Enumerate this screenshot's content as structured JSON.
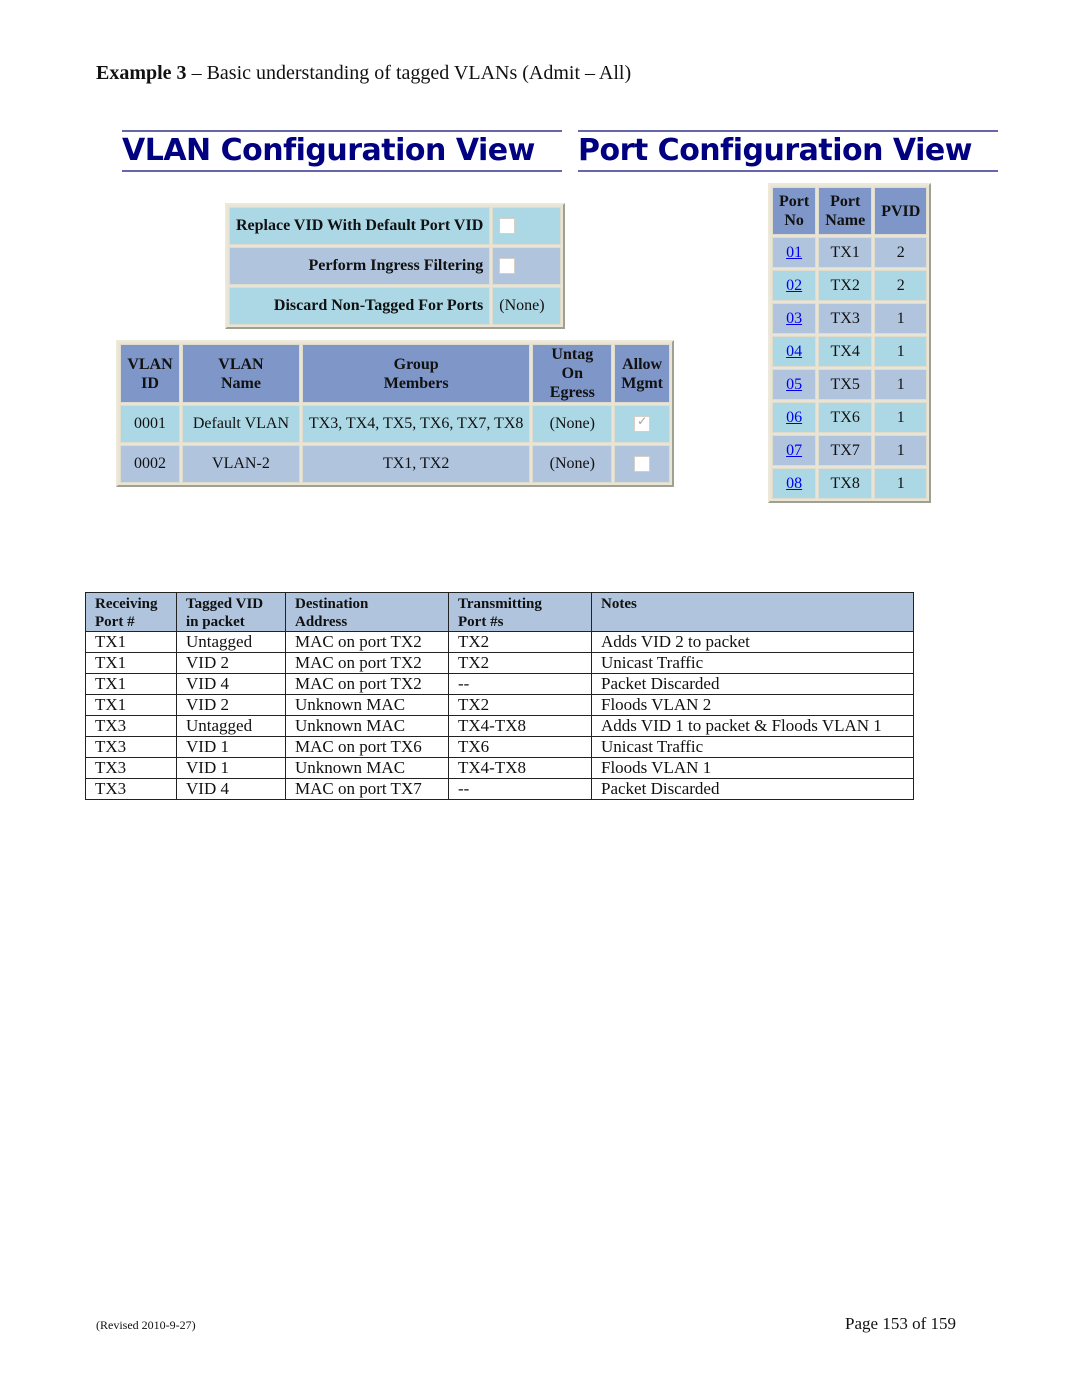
{
  "heading": {
    "bold": "Example 3",
    "rest": " – Basic understanding of tagged VLANs (Admit – All)"
  },
  "views": {
    "vlan_title": "VLAN Configuration View",
    "port_title": "Port Configuration View"
  },
  "options": [
    {
      "label": "Replace VID With Default Port VID",
      "type": "checkbox",
      "checked": false
    },
    {
      "label": "Perform Ingress Filtering",
      "type": "checkbox",
      "checked": false
    },
    {
      "label": "Discard Non-Tagged For Ports",
      "type": "text",
      "value": "(None)"
    }
  ],
  "vlan_table": {
    "headers": [
      [
        "VLAN",
        "ID"
      ],
      [
        "VLAN",
        "Name"
      ],
      [
        "Group",
        "Members"
      ],
      [
        "Untag On",
        "Egress"
      ],
      [
        "Allow",
        "Mgmt"
      ]
    ],
    "rows": [
      {
        "id": "0001",
        "name": "Default VLAN",
        "members": "TX3, TX4, TX5, TX6, TX7, TX8",
        "untag": "(None)",
        "allow_mgmt": true
      },
      {
        "id": "0002",
        "name": "VLAN-2",
        "members": "TX1, TX2",
        "untag": "(None)",
        "allow_mgmt": false
      }
    ]
  },
  "port_table": {
    "headers": [
      [
        "Port",
        "No"
      ],
      [
        "Port",
        "Name"
      ],
      [
        "PVID"
      ]
    ],
    "rows": [
      {
        "no": "01",
        "name": "TX1",
        "pvid": "2"
      },
      {
        "no": "02",
        "name": "TX2",
        "pvid": "2"
      },
      {
        "no": "03",
        "name": "TX3",
        "pvid": "1"
      },
      {
        "no": "04",
        "name": "TX4",
        "pvid": "1"
      },
      {
        "no": "05",
        "name": "TX5",
        "pvid": "1"
      },
      {
        "no": "06",
        "name": "TX6",
        "pvid": "1"
      },
      {
        "no": "07",
        "name": "TX7",
        "pvid": "1"
      },
      {
        "no": "08",
        "name": "TX8",
        "pvid": "1"
      }
    ]
  },
  "traffic_table": {
    "headers": [
      [
        "Receiving",
        "Port #"
      ],
      [
        "Tagged VID",
        "in packet"
      ],
      [
        "Destination",
        "Address"
      ],
      [
        "Transmitting",
        "Port #s"
      ],
      [
        "Notes",
        ""
      ]
    ],
    "rows": [
      [
        "TX1",
        "Untagged",
        "MAC on port TX2",
        "TX2",
        "Adds VID 2 to packet"
      ],
      [
        "TX1",
        "VID 2",
        "MAC on port TX2",
        "TX2",
        "Unicast Traffic"
      ],
      [
        "TX1",
        "VID 4",
        "MAC on port TX2",
        "--",
        "Packet Discarded"
      ],
      [
        "TX1",
        "VID 2",
        "Unknown MAC",
        "TX2",
        "Floods VLAN 2"
      ],
      [
        "TX3",
        "Untagged",
        "Unknown MAC",
        "TX4-TX8",
        "Adds VID 1 to packet & Floods VLAN 1"
      ],
      [
        "TX3",
        "VID 1",
        "MAC on port TX6",
        "TX6",
        "Unicast Traffic"
      ],
      [
        "TX3",
        "VID 1",
        "Unknown MAC",
        "TX4-TX8",
        "Floods VLAN 1"
      ],
      [
        "TX3",
        "VID 4",
        "MAC on port TX7",
        "--",
        "Packet Discarded"
      ]
    ]
  },
  "footer": {
    "revised": "(Revised 2010-9-27)",
    "page": "Page 153 of 159"
  },
  "colors": {
    "header_bg": "#7f96c8",
    "row_light": "#acd8e6",
    "row_blue": "#b0c4de",
    "title_color": "#000080",
    "link": "#0000ee"
  }
}
